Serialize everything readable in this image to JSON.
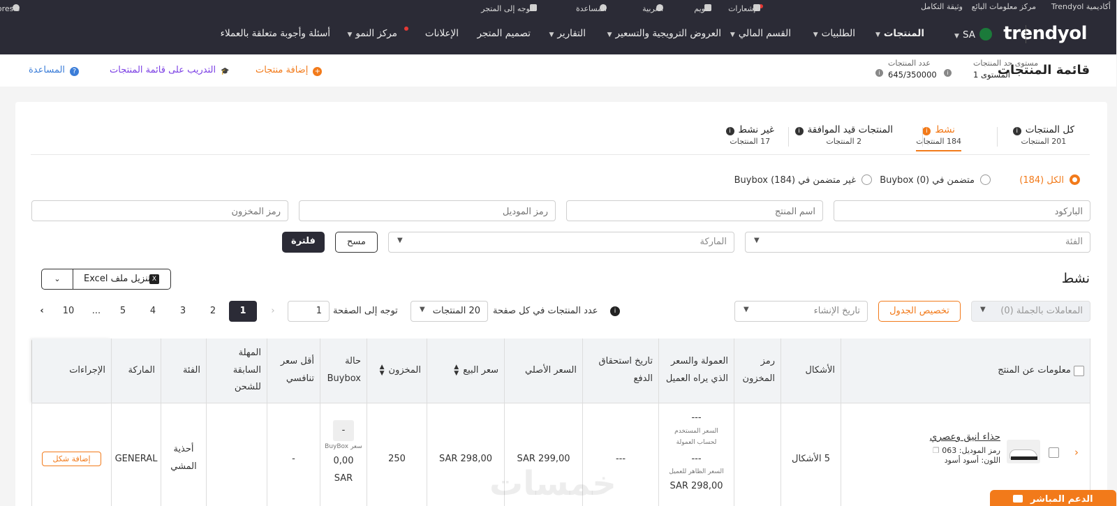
{
  "util_bar": {
    "academy": "أكاديمية Trendyol",
    "seller_info": "مركز معلومات البائع",
    "integration": "وثيقة التكامل",
    "notifications": "الإشعارات",
    "calendar": "تقويم",
    "language": "العربية",
    "help": "المساعدة",
    "go_to_store": "التوجه إلى المتجر",
    "user": "Casa presis"
  },
  "nav": {
    "logo": "trendyol",
    "country": "SA",
    "items": [
      "المنتجات",
      "الطلبيات",
      "القسم المالي",
      "العروض الترويجية والتسعير",
      "التقارير",
      "تصميم المتجر",
      "الإعلانات",
      "مركز النمو",
      "أسئلة وأجوبة متعلقة بالعملاء"
    ]
  },
  "subheader": {
    "title": "قائمة المنتجات",
    "limit_label": "مستوى حد المنتجات",
    "limit_value": "المستوى 1",
    "count_label": "عدد المنتجات",
    "count_value": "645/350000",
    "add_product": "إضافة منتجات",
    "training": "التدريب على قائمة المنتجات",
    "help": "المساعدة"
  },
  "tabs": [
    {
      "label": "كل المنتجات",
      "count": "201 المنتجات"
    },
    {
      "label": "نشط",
      "count": "184 المنتجات"
    },
    {
      "label": "المنتجات قيد الموافقة",
      "count": "2 المنتجات"
    },
    {
      "label": "غير نشط",
      "count": "17 المنتجات"
    }
  ],
  "radios": {
    "all": "الكل",
    "all_count": "(184)",
    "in_buybox": "متضمن في Buybox",
    "in_buybox_count": "(0)",
    "not_in_buybox": "غير متضمن في Buybox",
    "not_in_buybox_count": "(184)"
  },
  "filters": {
    "barcode": "الباركود",
    "product_name": "اسم المنتج",
    "model_code": "رمز الموديل",
    "stock_code": "رمز المخزون",
    "category": "الفئة",
    "brand": "الماركة",
    "clear": "مسح",
    "filter": "فلترة"
  },
  "section_title": "نشط",
  "download_excel": "تنزيل ملف Excel",
  "toolbar": {
    "bulk": "المعاملات بالجملة (0)",
    "sort": "تاريخ الإنشاء",
    "customize": "تخصيص الجدول",
    "per_page_label": "عدد المنتجات في كل صفحة",
    "per_page_value": "20 المنتجات",
    "goto_label": "توجه إلى الصفحة",
    "goto_value": "1"
  },
  "pagination": [
    "1",
    "2",
    "3",
    "4",
    "5",
    "...",
    "10"
  ],
  "columns": [
    "معلومات عن المنتج",
    "الأشكال",
    "رمز المخزون",
    "العمولة والسعر الذي يراه العميل",
    "تاريخ استحقاق الدفع",
    "السعر الأصلي",
    "سعر البيع",
    "المخزون",
    "حالة Buybox",
    "أقل سعر تنافسي",
    "المهلة السابقة للشحن",
    "الفئة",
    "الماركة",
    "الإجراءات"
  ],
  "row": {
    "name": "حذاء انيق وعصري",
    "model": "رمز الموديل: 063",
    "color": "اللون: أسود أسود",
    "variants": "5 الأشكال",
    "commission_dash1": "---",
    "commission_note1": "السعر المستخدم لحساب العمولة",
    "commission_dash2": "---",
    "commission_note2": "السعر الظاهر للعميل",
    "commission_price": "SAR 298,00",
    "due_date": "---",
    "original_price": "SAR 299,00",
    "sale_price": "SAR 298,00",
    "stock": "250",
    "buybox_dash": "-",
    "buybox_label": "سعر BuyBox",
    "buybox_price": "0,00",
    "buybox_currency": "SAR",
    "lowest": "-",
    "category": "أحذية المشي",
    "brand": "GENERAL",
    "action": "إضافة شكل"
  },
  "support": "الدعم المباشر",
  "watermark": "خمسات",
  "colors": {
    "accent": "#f27a1a",
    "nav_bg": "#2b2b36",
    "purple": "#7b3fe4",
    "blue": "#3b7dd8"
  }
}
